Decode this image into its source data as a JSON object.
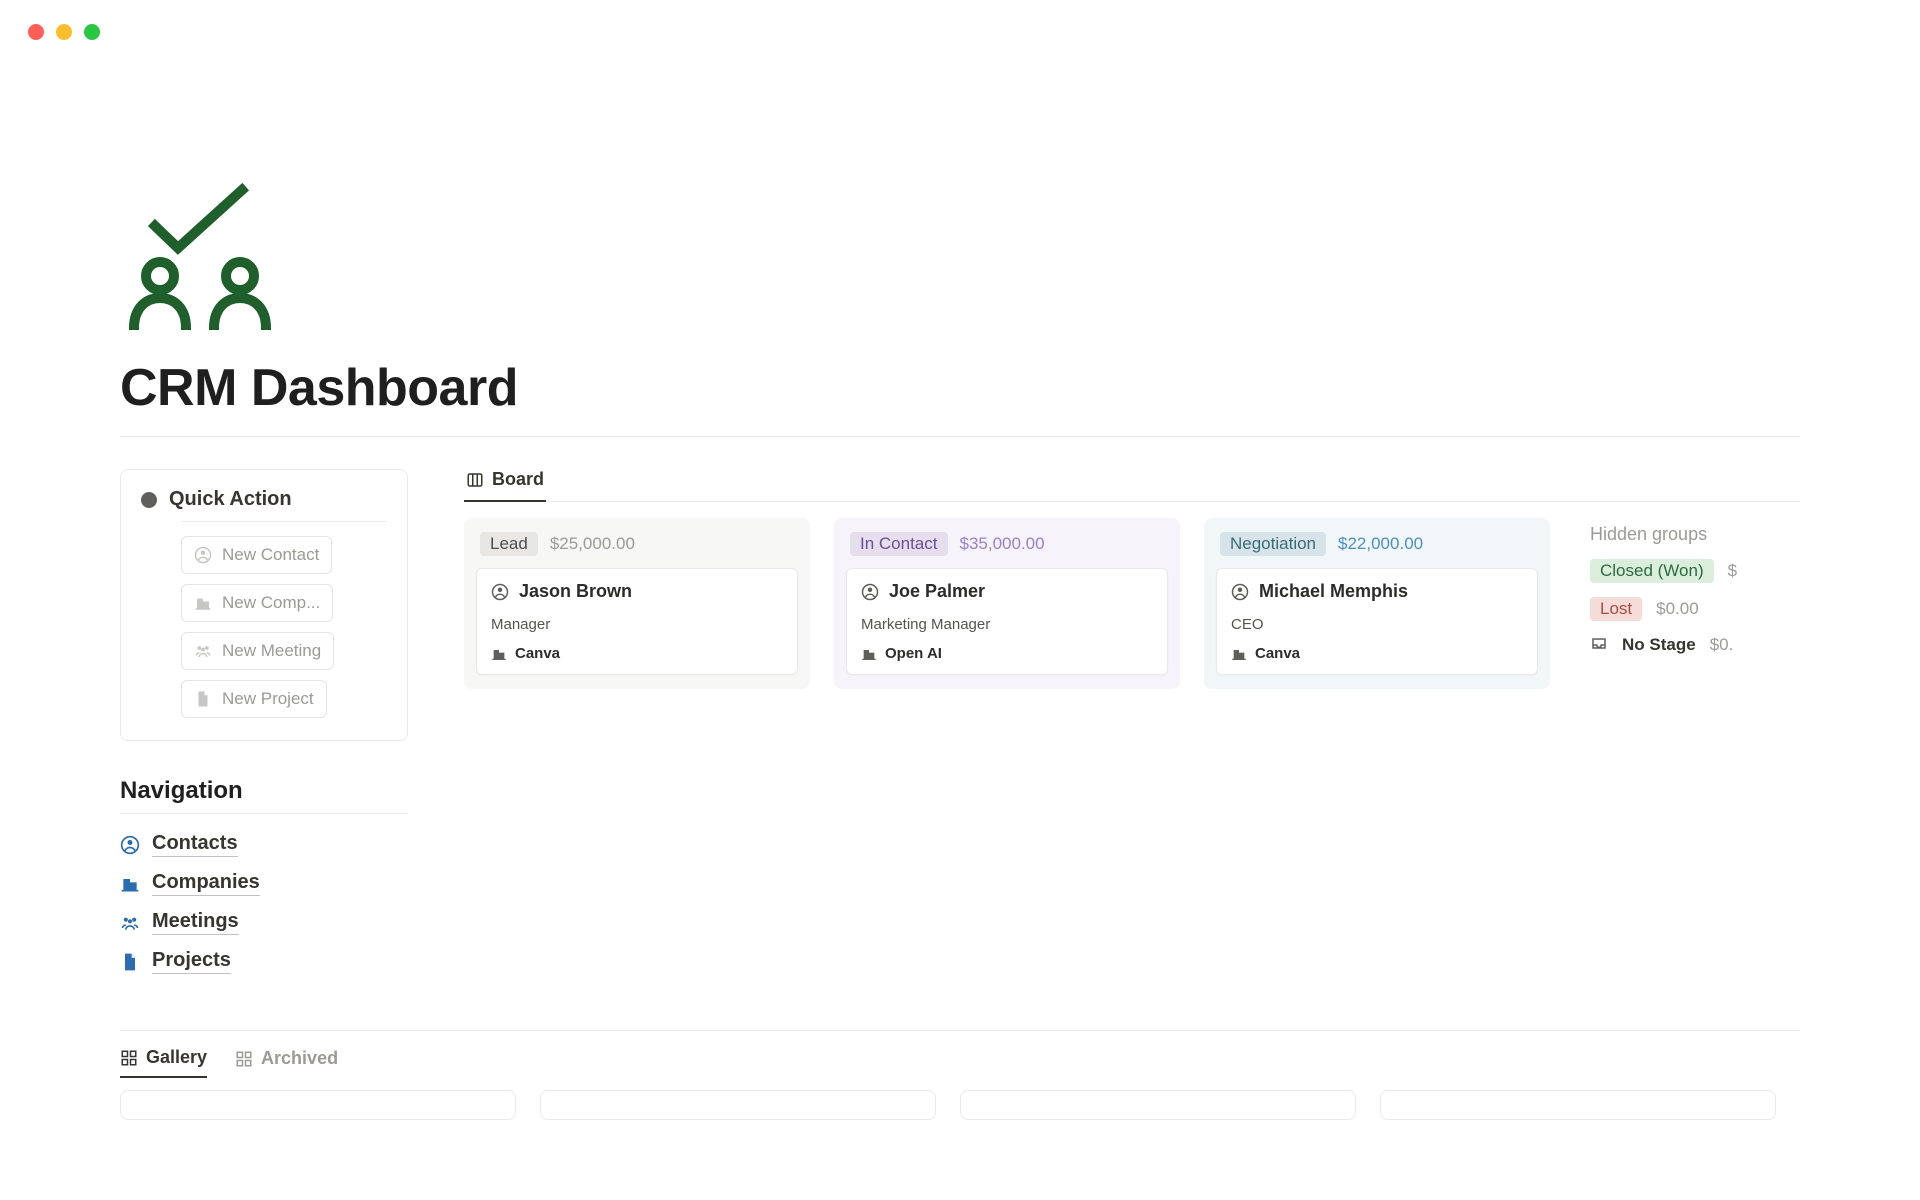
{
  "title": "CRM Dashboard",
  "quick": {
    "header": "Quick Action",
    "items": [
      {
        "label": "New Contact"
      },
      {
        "label": "New Comp..."
      },
      {
        "label": "New Meeting"
      },
      {
        "label": "New Project"
      }
    ]
  },
  "nav": {
    "header": "Navigation",
    "items": [
      {
        "label": "Contacts"
      },
      {
        "label": "Companies"
      },
      {
        "label": "Meetings"
      },
      {
        "label": "Projects"
      }
    ]
  },
  "board": {
    "tab": "Board",
    "columns": [
      {
        "name": "Lead",
        "amount": "$25,000.00",
        "card": {
          "name": "Jason Brown",
          "role": "Manager",
          "company": "Canva"
        }
      },
      {
        "name": "In Contact",
        "amount": "$35,000.00",
        "card": {
          "name": "Joe Palmer",
          "role": "Marketing Manager",
          "company": "Open AI"
        }
      },
      {
        "name": "Negotiation",
        "amount": "$22,000.00",
        "card": {
          "name": "Michael Memphis",
          "role": "CEO",
          "company": "Canva"
        }
      }
    ],
    "hidden": {
      "header": "Hidden groups",
      "rows": [
        {
          "label": "Closed (Won)",
          "amount": "$"
        },
        {
          "label": "Lost",
          "amount": "$0.00"
        },
        {
          "label": "No Stage",
          "amount": "$0."
        }
      ]
    }
  },
  "bottomTabs": {
    "gallery": "Gallery",
    "archived": "Archived"
  }
}
